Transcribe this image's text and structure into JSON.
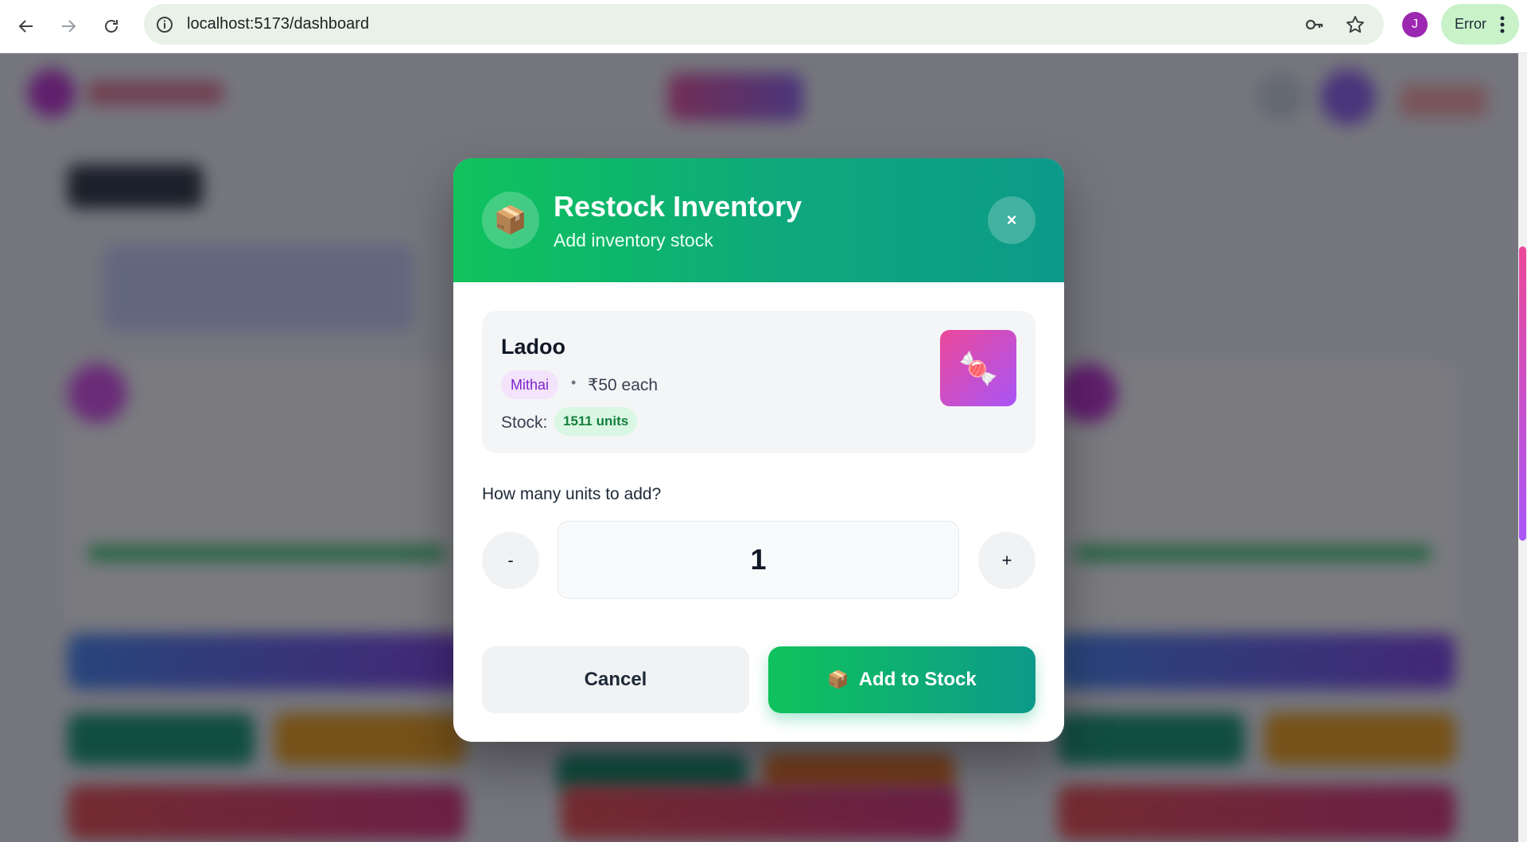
{
  "browser": {
    "url": "localhost:5173/dashboard",
    "profile_initial": "J",
    "profile_color": "#9c27b0",
    "status_label": "Error",
    "icons": [
      "back-arrow-icon",
      "forward-arrow-icon",
      "reload-icon",
      "site-info-icon",
      "password-key-icon",
      "bookmark-star-icon",
      "more-menu-icon"
    ]
  },
  "modal": {
    "header_icon": "📦",
    "title": "Restock Inventory",
    "subtitle": "Add inventory stock",
    "close_label": "×",
    "header_gradient": [
      "#0fc35c",
      "#0d9a8a"
    ],
    "product": {
      "name": "Ladoo",
      "category": "Mithai",
      "separator": "•",
      "price": "₹50 each",
      "stock_label": "Stock:",
      "stock_value": "1511 units",
      "thumbnail": "🍬"
    },
    "quantity": {
      "label": "How many units to add?",
      "minus_label": "-",
      "value": "1",
      "plus_label": "+"
    },
    "actions": {
      "cancel_label": "Cancel",
      "add_icon": "📦",
      "add_label": "Add to Stock"
    }
  }
}
